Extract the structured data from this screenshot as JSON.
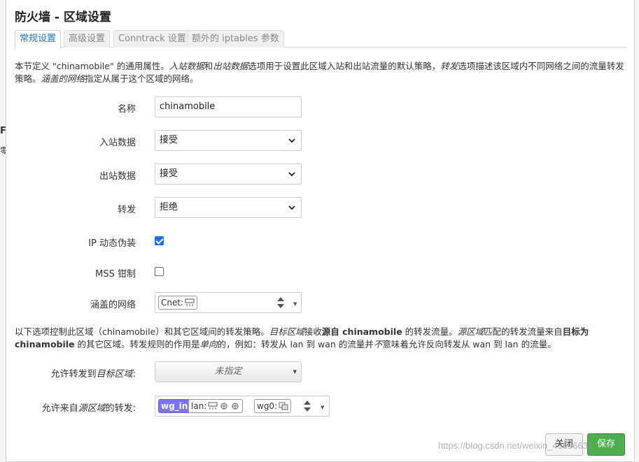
{
  "dialog": {
    "title": "防火墙 - 区域设置",
    "tabs": [
      {
        "label": "常规设置",
        "active": true
      },
      {
        "label": "高级设置",
        "active": false
      },
      {
        "label": "Conntrack 设置",
        "active": false
      },
      {
        "label": "额外的 iptables 参数",
        "active": false
      }
    ],
    "description": {
      "p1": "本节定义 \"chinamobile\" 的通用属性。",
      "inbound_term": "入站数据",
      "p2": "和",
      "outbound_term": "出站数据",
      "p3": "选项用于设置此区域入站和出站流量的默认策略，",
      "forward_term": "转发",
      "p4": "选项描述该区域内不同网络之间的流量转发策略。",
      "covered_term": "涵盖的网络",
      "p5": "指定从属于这个区域的网络。"
    }
  },
  "form": {
    "name": {
      "label": "名称",
      "value": "chinamobile"
    },
    "input": {
      "label": "入站数据",
      "value": "接受"
    },
    "output": {
      "label": "出站数据",
      "value": "接受"
    },
    "forward": {
      "label": "转发",
      "value": "拒绝"
    },
    "masq": {
      "label": "IP 动态伪装",
      "checked": true
    },
    "mss": {
      "label": "MSS 钳制",
      "checked": false
    },
    "networks": {
      "label": "涵盖的网络",
      "chips": [
        {
          "text": "Cnet:",
          "icon": "network-icon"
        }
      ]
    }
  },
  "forwarding": {
    "description": {
      "a": "以下选项控制此区域（chinamobile）和其它区域间的转发策略。",
      "b": "目标区域",
      "c": "接收",
      "d": "源自 chinamobile",
      "e": " 的转发流量。",
      "f": "源区域",
      "g": "匹配的转发流量来自",
      "h": "目标为 chinamobile",
      "i": " 的其它区域。转发规则的作用是",
      "j": "单向",
      "k": "的，例如：转发从 lan 到 wan 的流量并",
      "l": "不",
      "m": "意味着允许反向转发从 wan 到 lan 的流量。"
    },
    "dest": {
      "label_prefix": "允许转发到",
      "label_em": "目标区域",
      "label_suffix": ":",
      "value": "未指定"
    },
    "src": {
      "label_prefix": "允许来自",
      "label_em": "源区域",
      "label_suffix": "的转发:",
      "chips": [
        {
          "text": "wg_in",
          "selected": true
        },
        {
          "text": "lan:",
          "selected": false
        },
        {
          "text": "wg0:",
          "selected": false
        }
      ]
    }
  },
  "buttons": {
    "close": "关闭",
    "save": "保存"
  },
  "watermark": "https://blog.csdn.net/weixin_43696636",
  "background": {
    "mark1": "F",
    "mark2": "零"
  },
  "colors": {
    "accent": "#1e73be",
    "save": "#4cae4c",
    "chip_selected": "#7c74f0"
  }
}
